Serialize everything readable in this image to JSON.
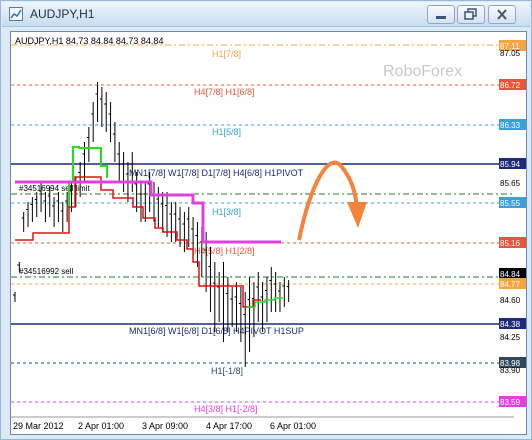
{
  "window": {
    "title": "AUDJPY,H1"
  },
  "chart": {
    "header_text": "AUDJPY,H1  84.73 84.84 84.73 84.84",
    "watermark": "RoboForex",
    "x_labels": [
      "29 Mar 2012",
      "2 Apr 01:00",
      "3 Apr 09:00",
      "4 Apr 17:00",
      "6 Apr 01:00"
    ],
    "price_labels": [
      {
        "text": "87.11",
        "bg": "#f7a542"
      },
      {
        "text": "87.05",
        "bg": "none"
      },
      {
        "text": "86.72",
        "bg": "#e8553a"
      },
      {
        "text": "86.33",
        "bg": "#3aa0d8"
      },
      {
        "text": "85.94",
        "bg": "#1c2c7a"
      },
      {
        "text": "85.65",
        "bg": "none"
      },
      {
        "text": "85.55",
        "bg": "#3aa0d8"
      },
      {
        "text": "85.16",
        "bg": "#e8553a"
      },
      {
        "text": "84.84",
        "bg": "#000000"
      },
      {
        "text": "84.77",
        "bg": "#f7a542"
      },
      {
        "text": "84.60",
        "bg": "none"
      },
      {
        "text": "84.38",
        "bg": "#1c2c7a"
      },
      {
        "text": "84.25",
        "bg": "none"
      },
      {
        "text": "83.98",
        "bg": "#2e4a5a"
      },
      {
        "text": "83.90",
        "bg": "none"
      },
      {
        "text": "83.59",
        "bg": "#e040e0"
      }
    ],
    "level_labels": [
      {
        "text": "H1[7/8]",
        "color": "#f7a542"
      },
      {
        "text": "H4[7/8] H1[6/8]",
        "color": "#e8553a"
      },
      {
        "text": "H1[5/8]",
        "color": "#3aa0d8"
      },
      {
        "text": "MN1[7/8] W1[7/8] D1[7/8] H4[6/8] H1PIVOT",
        "color": "#1c2c7a"
      },
      {
        "text": "H1[3/8]",
        "color": "#3aa0d8"
      },
      {
        "text": "H4[5/8] H1[2/8]",
        "color": "#e8553a"
      },
      {
        "text": "MN1[6/8] W1[6/8] D1[6/8] H4PIVOT H1SUP",
        "color": "#1c2c7a"
      },
      {
        "text": "H1[-1/8]",
        "color": "#2e4a5a"
      },
      {
        "text": "H4[3/8] H1[-2/8]",
        "color": "#e040e0"
      }
    ],
    "order_labels": [
      "#34516994 sell limit",
      "#34516992 sell"
    ],
    "arrow_color": "#f5843a"
  }
}
